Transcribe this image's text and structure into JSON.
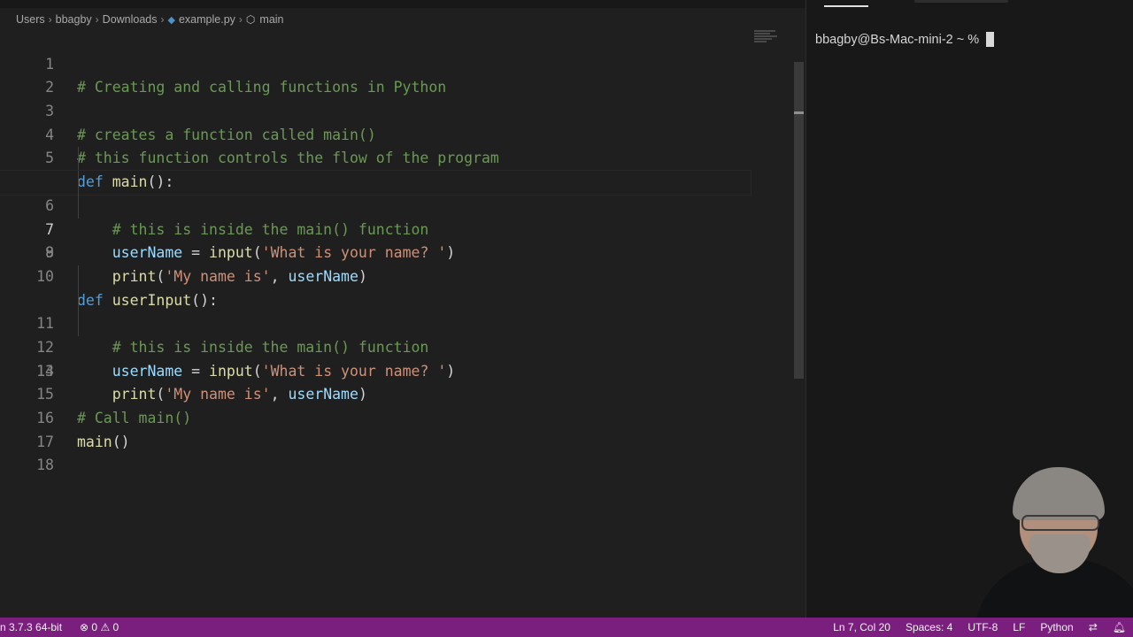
{
  "breadcrumb": {
    "items": [
      "Users",
      "bbagby",
      "Downloads",
      "example.py",
      "main"
    ]
  },
  "editor": {
    "current_line": 7,
    "lines": [
      {
        "n": "1"
      },
      {
        "n": "2"
      },
      {
        "n": "3"
      },
      {
        "n": "4"
      },
      {
        "n": "5"
      },
      {
        "n": "6"
      },
      {
        "n": "7"
      },
      {
        "n": "8"
      },
      {
        "n": "9"
      },
      {
        "n": "10"
      },
      {
        "n": "11"
      },
      {
        "n": "12"
      },
      {
        "n": "13"
      },
      {
        "n": "14"
      },
      {
        "n": "15"
      },
      {
        "n": "16"
      },
      {
        "n": "17"
      },
      {
        "n": "18"
      }
    ],
    "code": {
      "l1": "# Creating and calling functions in Python",
      "l3": "# creates a function called main()",
      "l4": "# this function controls the flow of the program",
      "l5_kw": "def",
      "l5_fn": "main",
      "l5_rest": "():",
      "l6": "# this is inside the main() function",
      "l7_var": "userName",
      "l7_op": " = ",
      "l7_fn": "input",
      "l7_open": "(",
      "l7_str": "'What is your name? '",
      "l7_close": ")",
      "l8_fn": "print",
      "l8_open": "(",
      "l8_str": "'My name is'",
      "l8_comma": ", ",
      "l8_var": "userName",
      "l8_close": ")",
      "l10_kw": "def",
      "l10_fn": "userInput",
      "l10_rest": "():",
      "l11": "# this is inside the main() function",
      "l12_var": "userName",
      "l12_op": " = ",
      "l12_fn": "input",
      "l12_open": "(",
      "l12_str": "'What is your name? '",
      "l12_close": ")",
      "l13_fn": "print",
      "l13_open": "(",
      "l13_str": "'My name is'",
      "l13_comma": ", ",
      "l13_var": "userName",
      "l13_close": ")",
      "l15": "# Call main()",
      "l16_fn": "main",
      "l16_rest": "()"
    }
  },
  "terminal": {
    "prompt": "bbagby@Bs-Mac-mini-2 ~ %"
  },
  "statusbar": {
    "interpreter": "n 3.7.3 64-bit",
    "errors": "0",
    "warnings": "0",
    "position": "Ln 7, Col 20",
    "spaces": "Spaces: 4",
    "encoding": "UTF-8",
    "eol": "LF",
    "language": "Python"
  },
  "colors": {
    "statusbar_bg": "#7a1f7d",
    "editor_bg": "#1f1f1f",
    "comment": "#6a9955",
    "keyword": "#569cd6",
    "function": "#dcdcaa",
    "string": "#ce9178",
    "variable": "#9cdcfe"
  }
}
